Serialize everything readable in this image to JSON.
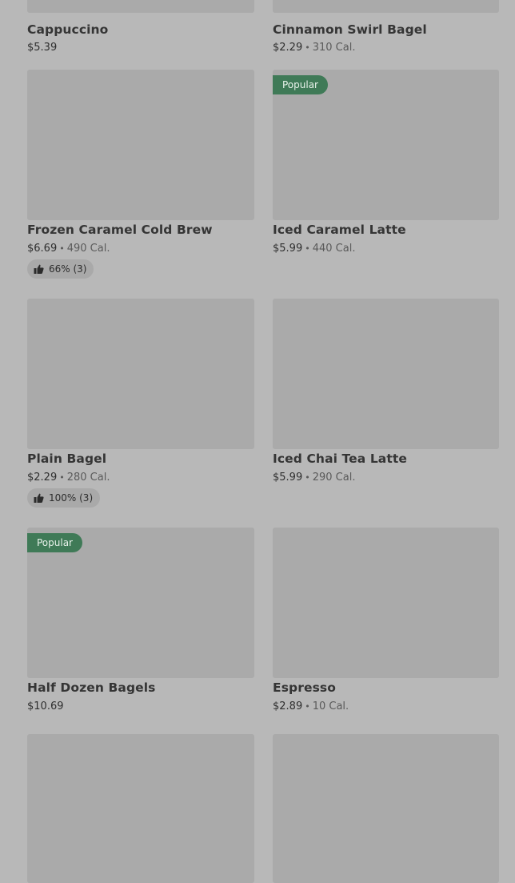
{
  "products": [
    {
      "name": "Cappuccino",
      "price": "$5.39",
      "calories": ""
    },
    {
      "name": "Cinnamon Swirl Bagel",
      "price": "$2.29",
      "calories": "310 Cal."
    },
    {
      "name": "Frozen Caramel Cold Brew",
      "price": "$6.69",
      "calories": "490 Cal.",
      "rating": "66% (3)"
    },
    {
      "name": "Iced Caramel Latte",
      "price": "$5.99",
      "calories": "440 Cal.",
      "badge": "Popular"
    },
    {
      "name": "Plain Bagel",
      "price": "$2.29",
      "calories": "280 Cal.",
      "rating": "100% (3)"
    },
    {
      "name": "Iced Chai Tea Latte",
      "price": "$5.99",
      "calories": "290 Cal."
    },
    {
      "name": "Half Dozen Bagels",
      "price": "$10.69",
      "calories": "",
      "badge": "Popular"
    },
    {
      "name": "Espresso",
      "price": "$2.89",
      "calories": "10 Cal."
    },
    {
      "name": "",
      "price": "",
      "calories": ""
    },
    {
      "name": "",
      "price": "",
      "calories": ""
    }
  ],
  "separator": "•",
  "icons": {
    "rating": "thumbs-up-icon"
  },
  "colors": {
    "badge": "#3f7a57",
    "background": "#b8b8b8",
    "thumbnail": "#aaaaaa"
  }
}
